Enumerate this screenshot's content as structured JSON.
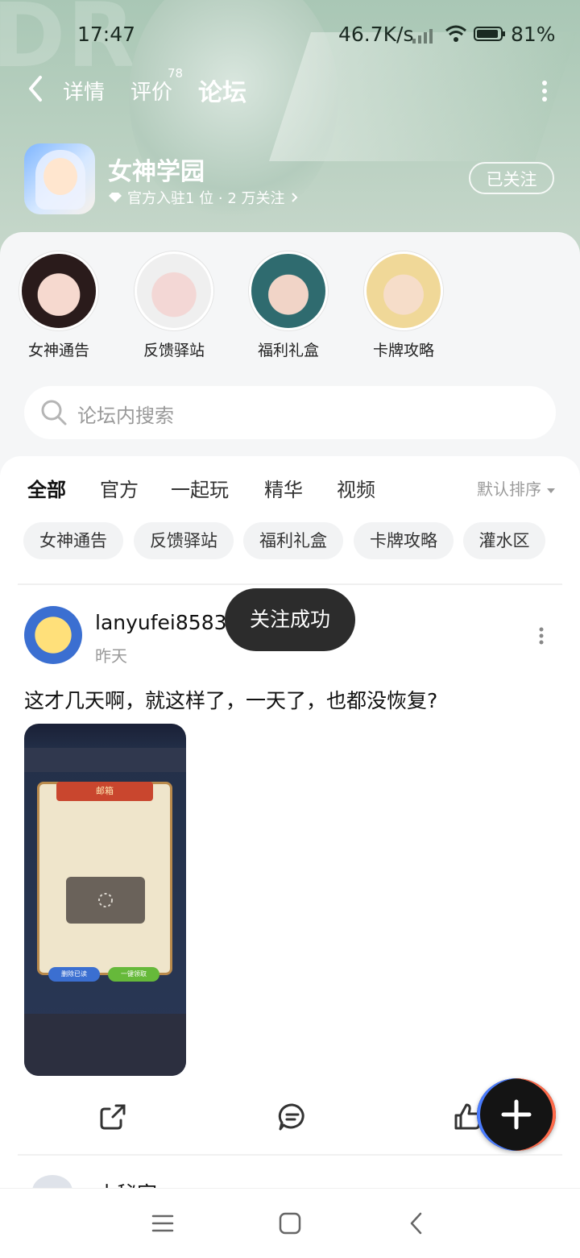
{
  "status_bar": {
    "time": "17:47",
    "network_speed": "46.7K/s",
    "battery": "81%"
  },
  "nav": {
    "tabs": [
      {
        "label": "详情"
      },
      {
        "label": "评价",
        "badge": "78"
      },
      {
        "label": "论坛"
      }
    ],
    "active_tab": "论坛"
  },
  "app": {
    "name": "女神学园",
    "meta": "官方入驻1 位 · 2 万关注",
    "follow_label": "已关注"
  },
  "categories": [
    {
      "label": "女神通告"
    },
    {
      "label": "反馈驿站"
    },
    {
      "label": "福利礼盒"
    },
    {
      "label": "卡牌攻略"
    }
  ],
  "search": {
    "placeholder": "论坛内搜索"
  },
  "feed_tabs": [
    "全部",
    "官方",
    "一起玩",
    "精华",
    "视频"
  ],
  "sort_label": "默认排序",
  "chips": [
    "女神通告",
    "反馈驿站",
    "福利礼盒",
    "卡牌攻略",
    "灌水区"
  ],
  "post": {
    "username": "lanyufei8583",
    "time": "昨天",
    "text": "这才几天啊，就这样了，一天了，也都没恢复?",
    "screenshot": {
      "dialog_title": "邮箱",
      "btn_left": "删除已读",
      "btn_right": "一键领取"
    }
  },
  "toast": "关注成功",
  "next_post": {
    "username": "小秘家"
  },
  "colors": {
    "accent": "#35d6a9",
    "toast_bg": "#2c2c2c",
    "hero_bg": "#b7cfbf"
  }
}
